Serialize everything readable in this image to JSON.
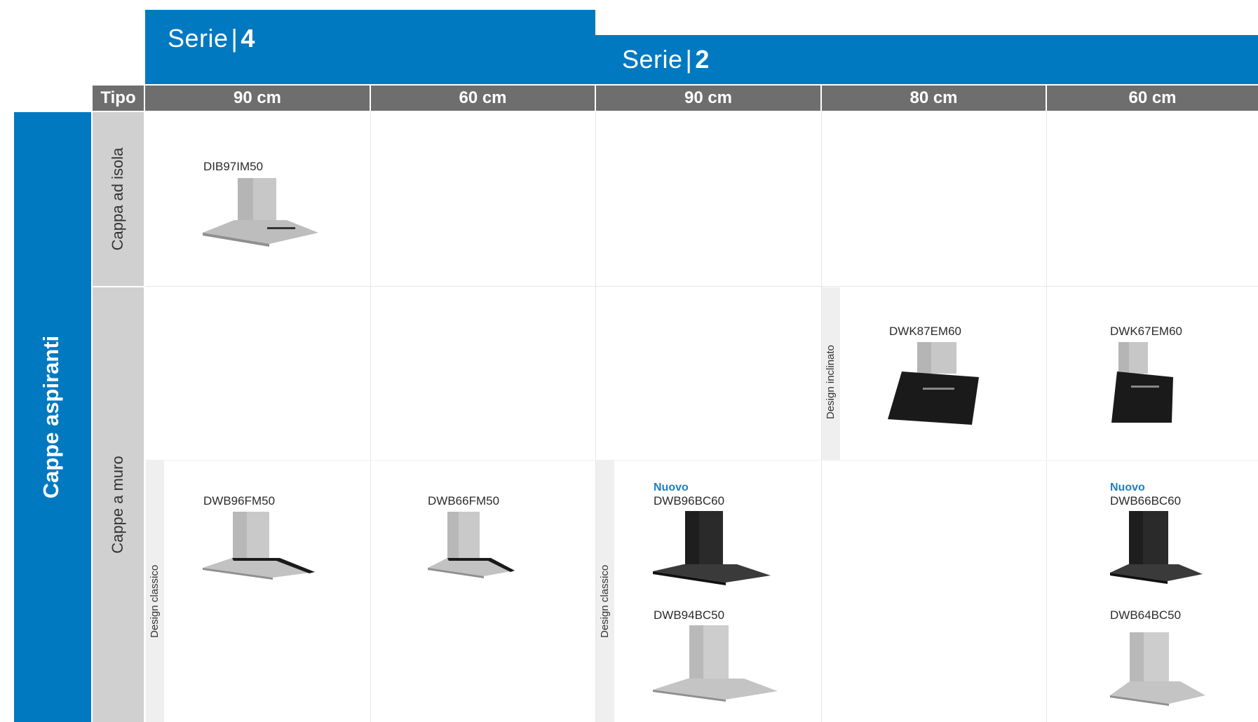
{
  "series": [
    {
      "label": "Serie",
      "number": "4"
    },
    {
      "label": "Serie",
      "number": "2"
    }
  ],
  "header": {
    "tipo": "Tipo",
    "columns": [
      "90 cm",
      "60 cm",
      "90 cm",
      "80 cm",
      "60 cm"
    ]
  },
  "category": "Cappe aspiranti",
  "types": [
    "Cappa ad isola",
    "Cappe a muro"
  ],
  "design_labels": {
    "classico": "Design classico",
    "inclinato": "Design inclinato"
  },
  "badge": "Nuovo",
  "products": [
    {
      "model": "DIB97IM50",
      "finish": "stainless",
      "style": "island"
    },
    {
      "model": "DWK87EM60",
      "finish": "black",
      "style": "inclined"
    },
    {
      "model": "DWK67EM60",
      "finish": "black",
      "style": "inclined"
    },
    {
      "model": "DWB96FM50",
      "finish": "stainless",
      "style": "flat"
    },
    {
      "model": "DWB66FM50",
      "finish": "stainless",
      "style": "flat"
    },
    {
      "model": "DWB96BC60",
      "finish": "black",
      "style": "box",
      "new": true
    },
    {
      "model": "DWB94BC50",
      "finish": "stainless",
      "style": "box"
    },
    {
      "model": "DWB66BC60",
      "finish": "black",
      "style": "box",
      "new": true
    },
    {
      "model": "DWB64BC50",
      "finish": "stainless",
      "style": "box"
    }
  ],
  "colors": {
    "brand_blue": "#0079c1",
    "header_gray": "#6e6e6e",
    "type_gray": "#d0d0d0",
    "new_badge": "#1f7fc1"
  }
}
